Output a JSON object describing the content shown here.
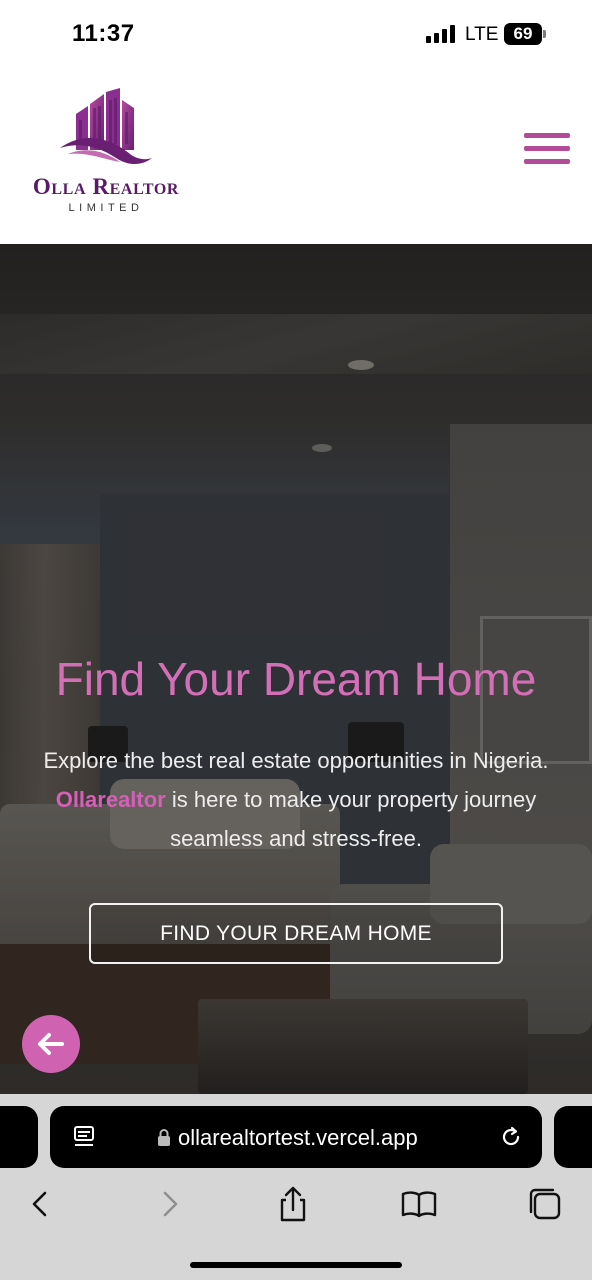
{
  "status_bar": {
    "time": "11:37",
    "network": "LTE",
    "battery": "69"
  },
  "header": {
    "logo_name": "Olla Realtor",
    "logo_subtitle": "LIMITED",
    "logo_color": "#8a2f8f",
    "menu_icon": "hamburger-menu-icon",
    "menu_color": "#b24c98"
  },
  "hero": {
    "title": "Find Your Dream Home",
    "text_before": "Explore the best real estate opportunities in Nigeria.",
    "brand": "Ollarealtor",
    "text_after": "is here to make your property journey seamless and stress-free.",
    "cta_label": "FIND YOUR DREAM HOME",
    "accent_color": "#d36fb6",
    "fab_icon": "arrow-left-icon"
  },
  "browser": {
    "url": "ollarealtortest.vercel.app",
    "icons": [
      "reader-icon",
      "lock-icon",
      "reload-icon",
      "back-icon",
      "forward-icon",
      "share-icon",
      "bookmarks-icon",
      "tabs-icon"
    ]
  }
}
